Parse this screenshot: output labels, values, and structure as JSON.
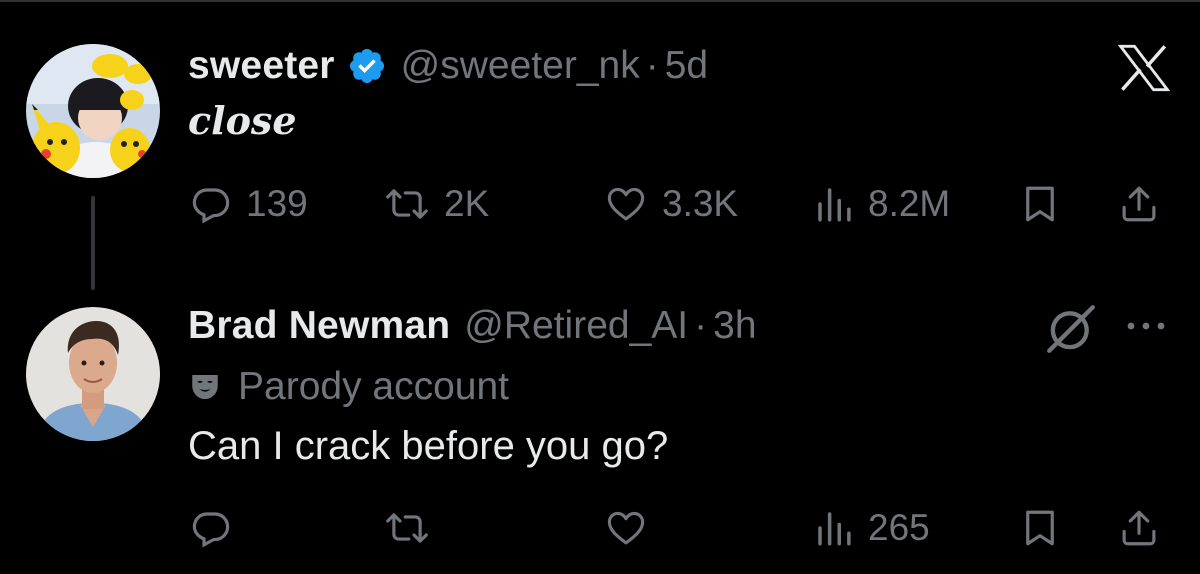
{
  "tweet": {
    "display_name": "sweeter",
    "handle": "@sweeter_nk",
    "separator": "·",
    "time": "5d",
    "text": "close",
    "verified": true,
    "metrics": {
      "replies": "139",
      "retweets": "2K",
      "likes": "3.3K",
      "views": "8.2M"
    }
  },
  "reply": {
    "display_name": "Brad Newman",
    "handle": "@Retired_AI",
    "separator": "·",
    "time": "3h",
    "parody_label": "Parody account",
    "text": "Can I crack before you go?",
    "metrics": {
      "replies": "",
      "retweets": "",
      "likes": "",
      "views": "265"
    }
  },
  "icons": {
    "app_logo": "x-logo",
    "verified": "verified-badge-icon",
    "parody": "mask-icon",
    "grok": "grok-icon",
    "more": "more-icon",
    "reply": "reply-icon",
    "retweet": "retweet-icon",
    "like": "heart-icon",
    "views": "views-icon",
    "bookmark": "bookmark-icon",
    "share": "share-icon"
  },
  "colors": {
    "background": "#000000",
    "primary_text": "#e7e9ea",
    "secondary_text": "#71767b",
    "verified_blue": "#1d9bf0",
    "thread_line": "#333639"
  }
}
